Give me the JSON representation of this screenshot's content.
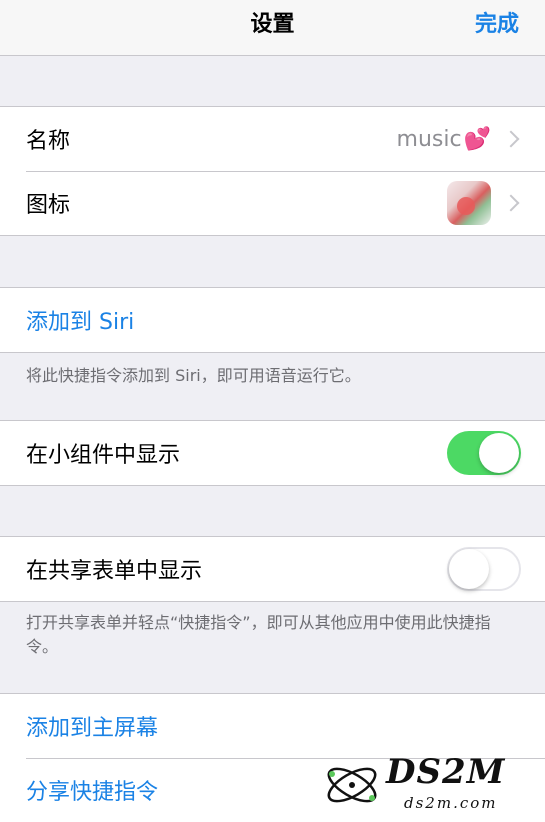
{
  "navbar": {
    "title": "设置",
    "done_label": "完成"
  },
  "name_row": {
    "label": "名称",
    "value": "music",
    "heart": "💕"
  },
  "icon_row": {
    "label": "图标"
  },
  "siri": {
    "label": "添加到 Siri",
    "footnote": "将此快捷指令添加到 Siri，即可用语音运行它。"
  },
  "widget": {
    "label": "在小组件中显示",
    "enabled": true
  },
  "share_sheet": {
    "label": "在共享表单中显示",
    "enabled": false,
    "footnote": "打开共享表单并轻点“快捷指令”，即可从其他应用中使用此快捷指令。"
  },
  "actions": {
    "home_screen": "添加到主屏幕",
    "share": "分享快捷指令"
  },
  "watermark": {
    "main": "DS2M",
    "sub": "ds2m.com"
  },
  "colors": {
    "accent": "#1a82e5",
    "switch_on": "#4cd964",
    "background": "#efeff4"
  }
}
